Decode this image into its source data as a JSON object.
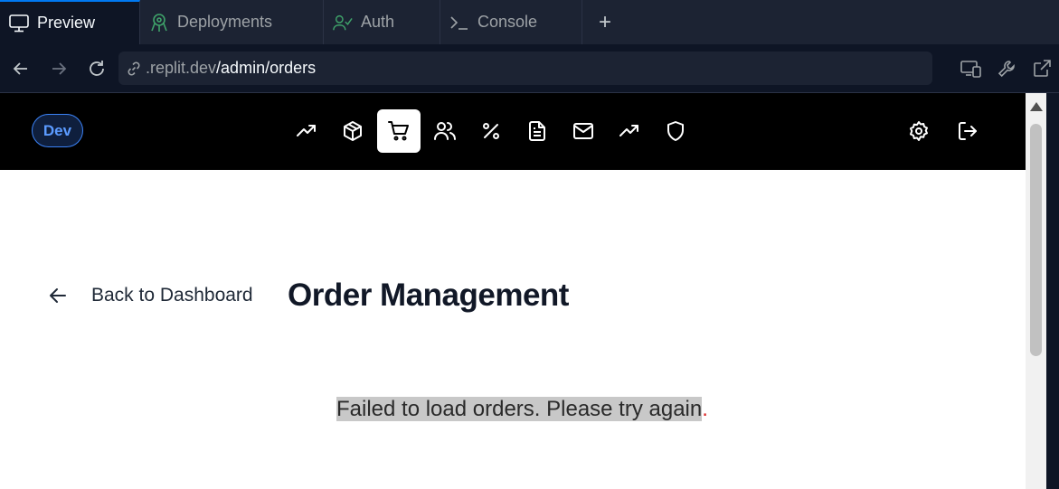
{
  "tabs": [
    {
      "label": "Preview",
      "icon": "monitor-icon",
      "active": true
    },
    {
      "label": "Deployments",
      "icon": "deployments-icon",
      "active": false
    },
    {
      "label": "Auth",
      "icon": "users-check-icon",
      "active": false
    },
    {
      "label": "Console",
      "icon": "terminal-icon",
      "active": false
    }
  ],
  "add_tab_label": "+",
  "address": {
    "host": ".replit.dev",
    "path": "/admin/orders"
  },
  "app": {
    "env_badge": "Dev",
    "nav_icons": [
      "trending-up-icon",
      "package-icon",
      "shopping-cart-icon",
      "users-icon",
      "percent-icon",
      "file-text-icon",
      "mail-icon",
      "trending-up-icon",
      "shield-icon"
    ],
    "active_nav": "shopping-cart-icon",
    "right_icons": [
      "settings-icon",
      "logout-icon"
    ]
  },
  "page": {
    "back_label": "Back to Dashboard",
    "title": "Order Management",
    "error_text": "Failed to load orders. Please try again",
    "error_punct": "."
  },
  "colors": {
    "accent": "#0079f2",
    "badge_blue": "#5b9bff",
    "error_red": "#dc2626"
  }
}
